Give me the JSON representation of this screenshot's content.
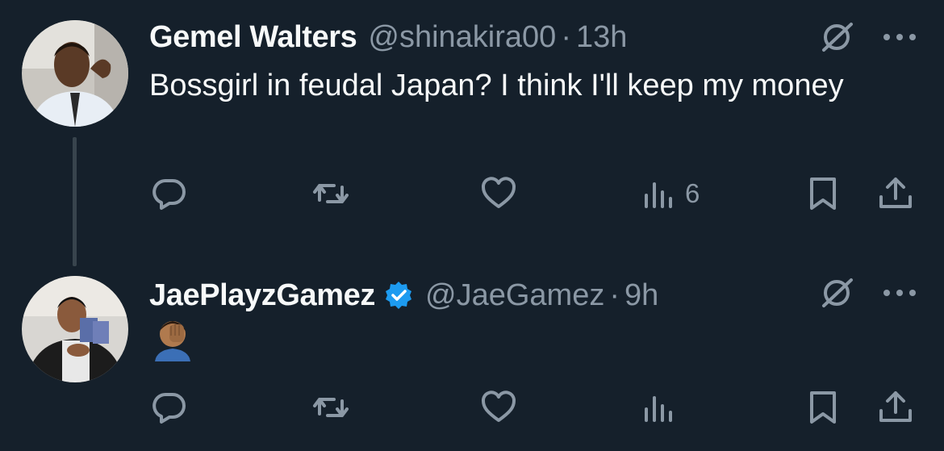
{
  "tweets": [
    {
      "author_name": "Gemel Walters",
      "handle": "@shinakira00",
      "separator": "·",
      "time": "13h",
      "text": "Bossgirl in feudal Japan? I think I'll keep my money",
      "views": "6",
      "verified": false
    },
    {
      "author_name": "JaePlayzGamez",
      "handle": "@JaeGamez",
      "separator": "·",
      "time": "9h",
      "text": "",
      "emoji": "face-palm",
      "views": "",
      "verified": true
    }
  ],
  "colors": {
    "background": "#15202b",
    "text": "#f7f9f9",
    "muted": "#8b98a5",
    "verified": "#1d9bf0",
    "thread_line": "#38444d"
  },
  "icons": [
    "reply-icon",
    "retweet-icon",
    "like-icon",
    "views-icon",
    "bookmark-icon",
    "share-icon",
    "grok-icon",
    "more-icon",
    "verified-badge-icon"
  ]
}
